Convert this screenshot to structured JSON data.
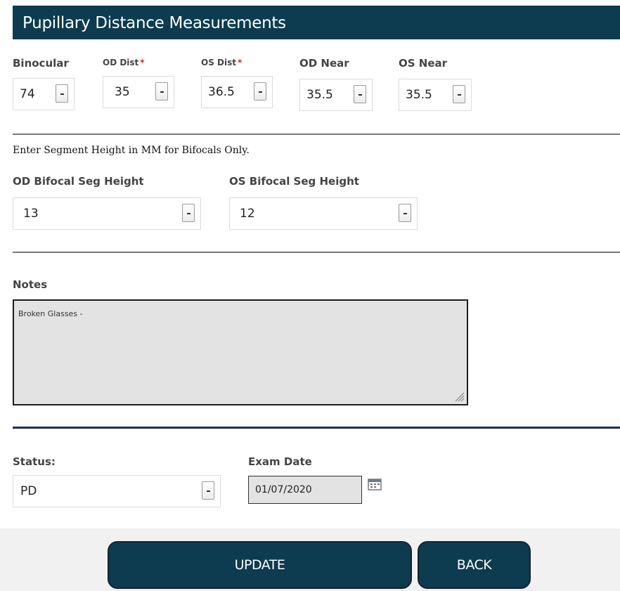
{
  "header": {
    "title": "Pupillary Distance Measurements"
  },
  "pd": {
    "binocular": {
      "label": "Binocular",
      "value": "74"
    },
    "od_dist": {
      "label": "OD Dist",
      "required_mark": "*",
      "value": "35"
    },
    "os_dist": {
      "label": "OS Dist",
      "required_mark": "*",
      "value": "36.5"
    },
    "od_near": {
      "label": "OD Near",
      "value": "35.5"
    },
    "os_near": {
      "label": "OS Near",
      "value": "35.5"
    }
  },
  "bifocal": {
    "instruction": "Enter Segment Height in MM for Bifocals Only.",
    "od": {
      "label": "OD Bifocal Seg Height",
      "value": "13"
    },
    "os": {
      "label": "OS Bifocal Seg Height",
      "value": "12"
    }
  },
  "notes": {
    "label": "Notes",
    "value": "Broken Glasses -"
  },
  "status": {
    "label": "Status:",
    "value": "PD"
  },
  "exam_date": {
    "label": "Exam Date",
    "value": "01/07/2020"
  },
  "actions": {
    "update_label": "UPDATE",
    "back_label": "BACK"
  },
  "colors": {
    "header_bg": "#0d3b4f",
    "required": "#e02020",
    "divider_blue": "#1a2f5e"
  }
}
